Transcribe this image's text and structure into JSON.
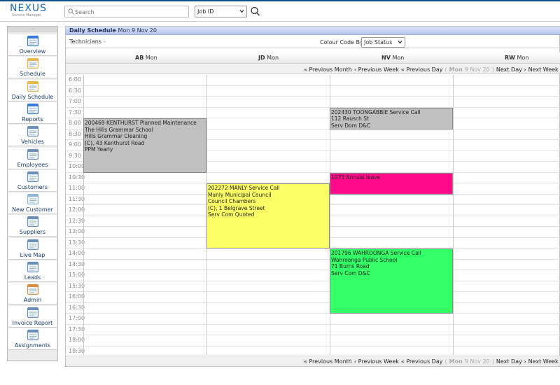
{
  "app": {
    "logo_text": "NEXUS",
    "logo_subtitle": "Service Manager",
    "brand_color": "#1b6cb6"
  },
  "search": {
    "placeholder": "Search",
    "field_select": "Job ID",
    "button_icon": "search-icon"
  },
  "sidebar": {
    "collapse": "–",
    "items": [
      {
        "label": "Overview",
        "icon": "overview-icon"
      },
      {
        "label": "Schedule",
        "icon": "schedule-icon"
      },
      {
        "label": "Daily Schedule",
        "icon": "daily-schedule-icon"
      },
      {
        "label": "Reports",
        "icon": "reports-icon"
      },
      {
        "label": "Vehicles",
        "icon": "vehicles-icon"
      },
      {
        "label": "Employees",
        "icon": "employees-icon"
      },
      {
        "label": "Customers",
        "icon": "customers-icon"
      },
      {
        "label": "New Customer",
        "icon": "new-customer-icon"
      },
      {
        "label": "Suppliers",
        "icon": "suppliers-icon"
      },
      {
        "label": "Live Map",
        "icon": "live-map-icon"
      },
      {
        "label": "Leads",
        "icon": "leads-icon"
      },
      {
        "label": "Admin",
        "icon": "admin-icon"
      },
      {
        "label": "Invoice Report",
        "icon": "invoice-report-icon"
      },
      {
        "label": "Assignments",
        "icon": "assignments-icon"
      }
    ]
  },
  "panel": {
    "title": "Daily Schedule",
    "date": "Mon 9 Nov 20",
    "technicians_label": "Technicians",
    "technicians_caret": "–",
    "colour_code_label": "Colour Code By",
    "colour_code_value": "Job Status"
  },
  "columns": [
    {
      "code": "AB",
      "day": "Mon"
    },
    {
      "code": "JD",
      "day": "Mon"
    },
    {
      "code": "NV",
      "day": "Mon"
    },
    {
      "code": "RW",
      "day": "Mon"
    }
  ],
  "nav": {
    "prev_month": "« Previous Month",
    "prev_week": "‹ Previous Week",
    "prev_day": "« Previous Day",
    "current_open": "(",
    "current_day": "Mon",
    "current_date": "9 Nov 20",
    "current_close": ")",
    "next_day": "Next Day ›",
    "next_week": "Next Week »",
    "next_month": "Nex"
  },
  "times": [
    "6:00",
    "6:30",
    "7:00",
    "7:30",
    "8:00",
    "8:30",
    "9:00",
    "9:30",
    "10:00",
    "10:30",
    "11:00",
    "11:30",
    "12:00",
    "12:30",
    "13:00",
    "13:30",
    "14:00",
    "14:30",
    "15:00",
    "15:30",
    "16:00",
    "16:30",
    "17:00",
    "17:30",
    "18:00",
    "18:30"
  ],
  "events": [
    {
      "column": 0,
      "start": "8:00",
      "end": "10:30",
      "color": "#c0c0c0",
      "lines": [
        "200469 KENTHURST Planned Maintenance",
        "The Hills Grammar School",
        "Hills Grammar Cleaning",
        "(C), 43 Kenthurst Road",
        "PPM Yearly"
      ]
    },
    {
      "column": 1,
      "start": "11:00",
      "end": "14:00",
      "color": "#ffff66",
      "lines": [
        "202272 MANLY Service Call",
        "Manly Municipal Council",
        "Council Chambers",
        "(C), 1 Belgrave Street",
        "Serv Com Quoted"
      ]
    },
    {
      "column": 2,
      "start": "7:30",
      "end": "8:30",
      "color": "#c0c0c0",
      "lines": [
        "202430 TOONGABBIE Service Call",
        "112 Rausch St",
        "Serv Dom D&C"
      ]
    },
    {
      "column": 2,
      "start": "10:30",
      "end": "11:30",
      "color": "#ff0a88",
      "lines": [
        "1075 Annual leave"
      ]
    },
    {
      "column": 2,
      "start": "14:00",
      "end": "17:00",
      "color": "#33ff66",
      "lines": [
        "201796 WAHROONGA Service Call",
        "Wahroonga Public School",
        "71 Burns Road",
        "Serv Com D&C"
      ]
    }
  ]
}
